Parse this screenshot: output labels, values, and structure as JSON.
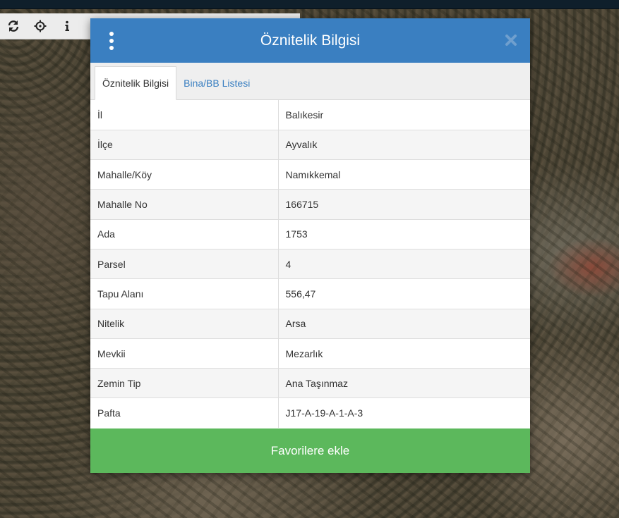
{
  "modal": {
    "title": "Öznitelik Bilgisi",
    "tabs": [
      {
        "label": "Öznitelik Bilgisi",
        "active": true
      },
      {
        "label": "Bina/BB Listesi",
        "active": false
      }
    ],
    "rows": [
      {
        "key": "İl",
        "value": "Balıkesir"
      },
      {
        "key": "İlçe",
        "value": "Ayvalık"
      },
      {
        "key": "Mahalle/Köy",
        "value": "Namıkkemal"
      },
      {
        "key": "Mahalle No",
        "value": "166715"
      },
      {
        "key": "Ada",
        "value": "1753"
      },
      {
        "key": "Parsel",
        "value": "4"
      },
      {
        "key": "Tapu Alanı",
        "value": "556,47"
      },
      {
        "key": "Nitelik",
        "value": "Arsa"
      },
      {
        "key": "Mevkii",
        "value": "Mezarlık"
      },
      {
        "key": "Zemin Tip",
        "value": "Ana Taşınmaz"
      },
      {
        "key": "Pafta",
        "value": "J17-A-19-A-1-A-3"
      }
    ],
    "favorite_button": "Favorilere ekle"
  },
  "toolbar": {
    "icons": [
      "refresh-icon",
      "crosshair-icon",
      "info-icon"
    ]
  },
  "colors": {
    "header": "#3a7fc1",
    "favorite": "#5cb85c",
    "tab_link": "#3a7fc1"
  }
}
